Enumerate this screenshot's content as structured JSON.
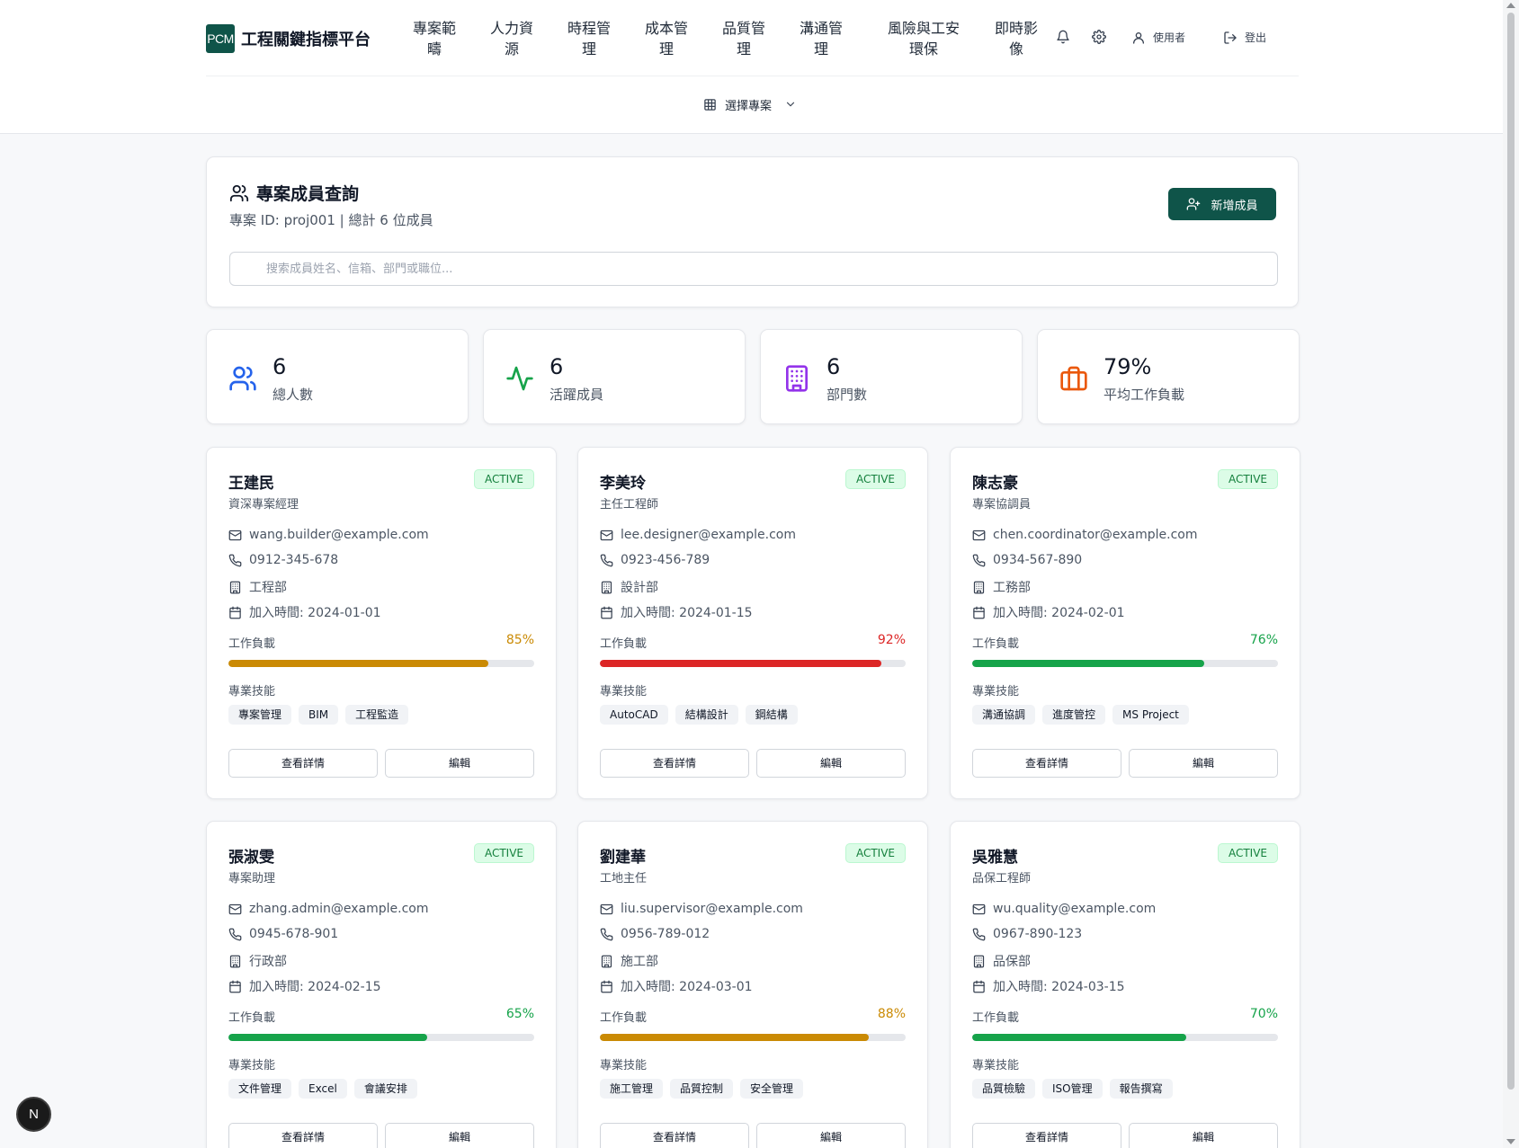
{
  "brand": {
    "logo": "PCM",
    "title": "工程關鍵指標平台"
  },
  "nav": [
    {
      "line1": "專案範",
      "line2": "疇"
    },
    {
      "line1": "人力資",
      "line2": "源"
    },
    {
      "line1": "時程管",
      "line2": "理"
    },
    {
      "line1": "成本管",
      "line2": "理"
    },
    {
      "line1": "品質管",
      "line2": "理"
    },
    {
      "line1": "溝通管",
      "line2": "理"
    },
    {
      "line1": "風險與工安",
      "line2": "環保"
    },
    {
      "line1": "即時影",
      "line2": "像"
    }
  ],
  "header_tools": {
    "bell_icon": "bell-icon",
    "settings_icon": "gear-icon",
    "user_label": "使用者",
    "logout_label": "登出"
  },
  "project_select": {
    "label": "選擇專案",
    "icon": "grid-icon"
  },
  "members_panel": {
    "title": "專案成員查詢",
    "subtitle": "專案 ID: proj001 | 總計 6 位成員",
    "add_button": "新增成員",
    "search_placeholder": "搜索成員姓名、信箱、部門或職位..."
  },
  "stats": [
    {
      "value": "6",
      "label": "總人數",
      "icon": "users-icon",
      "color": "#2563eb"
    },
    {
      "value": "6",
      "label": "活躍成員",
      "icon": "activity-icon",
      "color": "#16a34a"
    },
    {
      "value": "6",
      "label": "部門數",
      "icon": "building-icon",
      "color": "#9333ea"
    },
    {
      "value": "79%",
      "label": "平均工作負載",
      "icon": "briefcase-icon",
      "color": "#ea580c"
    }
  ],
  "labels": {
    "workload": "工作負載",
    "skills": "專業技能",
    "detail_button": "查看詳情",
    "edit_button": "編輯",
    "joined_prefix": "加入時間: "
  },
  "colors": {
    "brand": "#0f5449",
    "green": "#16a34a",
    "amber": "#ca8a04",
    "red": "#dc2626"
  },
  "members": [
    {
      "name": "王建民",
      "role": "資深專案經理",
      "status": "ACTIVE",
      "email": "wang.builder@example.com",
      "phone": "0912-345-678",
      "department": "工程部",
      "joined": "加入時間: 2024-01-01",
      "workload": 85,
      "workload_text": "85%",
      "level": "amber",
      "skills": [
        "專案管理",
        "BIM",
        "工程監造"
      ]
    },
    {
      "name": "李美玲",
      "role": "主任工程師",
      "status": "ACTIVE",
      "email": "lee.designer@example.com",
      "phone": "0923-456-789",
      "department": "設計部",
      "joined": "加入時間: 2024-01-15",
      "workload": 92,
      "workload_text": "92%",
      "level": "red",
      "skills": [
        "AutoCAD",
        "結構設計",
        "鋼結構"
      ]
    },
    {
      "name": "陳志豪",
      "role": "專案協調員",
      "status": "ACTIVE",
      "email": "chen.coordinator@example.com",
      "phone": "0934-567-890",
      "department": "工務部",
      "joined": "加入時間: 2024-02-01",
      "workload": 76,
      "workload_text": "76%",
      "level": "green",
      "skills": [
        "溝通協調",
        "進度管控",
        "MS Project"
      ]
    },
    {
      "name": "張淑雯",
      "role": "專案助理",
      "status": "ACTIVE",
      "email": "zhang.admin@example.com",
      "phone": "0945-678-901",
      "department": "行政部",
      "joined": "加入時間: 2024-02-15",
      "workload": 65,
      "workload_text": "65%",
      "level": "green",
      "skills": [
        "文件管理",
        "Excel",
        "會議安排"
      ]
    },
    {
      "name": "劉建華",
      "role": "工地主任",
      "status": "ACTIVE",
      "email": "liu.supervisor@example.com",
      "phone": "0956-789-012",
      "department": "施工部",
      "joined": "加入時間: 2024-03-01",
      "workload": 88,
      "workload_text": "88%",
      "level": "amber",
      "skills": [
        "施工管理",
        "品質控制",
        "安全管理"
      ]
    },
    {
      "name": "吳雅慧",
      "role": "品保工程師",
      "status": "ACTIVE",
      "email": "wu.quality@example.com",
      "phone": "0967-890-123",
      "department": "品保部",
      "joined": "加入時間: 2024-03-15",
      "workload": 70,
      "workload_text": "70%",
      "level": "green",
      "skills": [
        "品質檢驗",
        "ISO管理",
        "報告撰寫"
      ]
    }
  ],
  "dev_badge": "N"
}
